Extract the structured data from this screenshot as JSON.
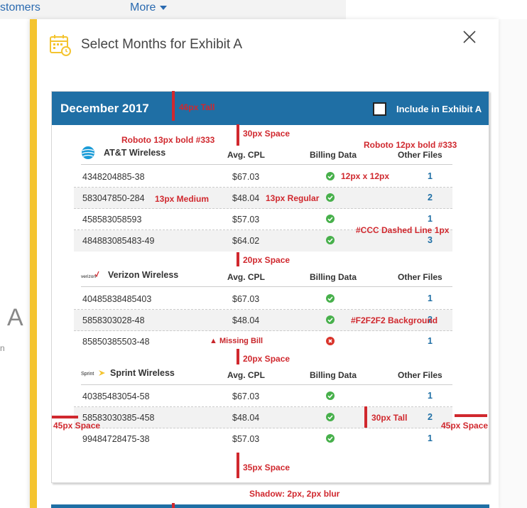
{
  "nav": {
    "customers": "stomers",
    "more": "More"
  },
  "background": {
    "letter": "A",
    "fragment": "n"
  },
  "modal": {
    "title": "Select Months for Exhibit A"
  },
  "card": {
    "month": "December 2017",
    "include_label": "Include in Exhibit A",
    "columns": {
      "cpl": "Avg. CPL",
      "billing": "Billing Data",
      "other": "Other Files"
    },
    "carriers": [
      {
        "name": "AT&T Wireless",
        "logo": "att-logo",
        "rows": [
          {
            "account": "4348204885-38",
            "cpl": "$67.03",
            "status": "ok",
            "files": "1"
          },
          {
            "account": "583047850-284",
            "cpl": "$48.04",
            "status": "ok",
            "files": "2"
          },
          {
            "account": "458583058593",
            "cpl": "$57.03",
            "status": "ok",
            "files": "1"
          },
          {
            "account": "484883085483-49",
            "cpl": "$64.02",
            "status": "ok",
            "files": "3"
          }
        ]
      },
      {
        "name": "Verizon Wireless",
        "logo": "verizon-logo",
        "logo_text": "verizon",
        "rows": [
          {
            "account": "40485838485403",
            "cpl": "$67.03",
            "status": "ok",
            "files": "1"
          },
          {
            "account": "5858303028-48",
            "cpl": "$48.04",
            "status": "ok",
            "files": "2"
          },
          {
            "account": "85850385503-48",
            "cpl": "",
            "missing": "Missing Bill",
            "status": "bad",
            "files": "1"
          }
        ]
      },
      {
        "name": "Sprint Wireless",
        "logo": "sprint-logo",
        "logo_text": "Sprint",
        "rows": [
          {
            "account": "40385483054-58",
            "cpl": "$67.03",
            "status": "ok",
            "files": "1"
          },
          {
            "account": "58583030385-458",
            "cpl": "$48.04",
            "status": "ok",
            "files": "2"
          },
          {
            "account": "99484728475-38",
            "cpl": "$57.03",
            "status": "ok",
            "files": "1"
          }
        ]
      }
    ]
  },
  "annotations": {
    "header_tall": "46px Tall",
    "space_30": "30px Space",
    "roboto_13": "Roboto 13px bold #333",
    "roboto_12": "Roboto 12px bold #333",
    "icon_size": "12px x 12px",
    "medium_13": "13px Medium",
    "regular_13": "13px Regular",
    "dashed_line": "#CCC Dashed Line 1px",
    "space_20a": "20px Space",
    "bg_color": "#F2F2F2 Background",
    "space_20b": "20px Space",
    "tall_30": "30px Tall",
    "space_45_left": "45px Space",
    "space_45_right": "45px Space",
    "space_35": "35px Space",
    "shadow": "Shadow: 2px, 2px blur"
  },
  "colors": {
    "header": "#1f6fa5",
    "accent_bar": "#f4c430",
    "ok": "#47b04b",
    "bad": "#d9342b",
    "annotation": "#d0282e",
    "row_shade": "#f2f2f2"
  }
}
